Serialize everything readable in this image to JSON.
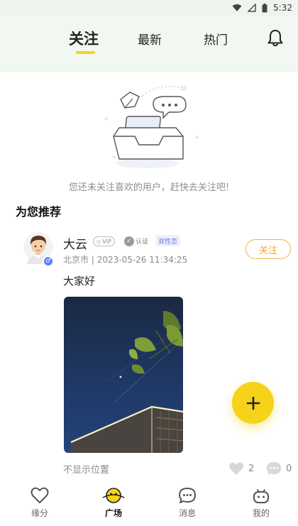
{
  "status_bar": {
    "time": "5:32"
  },
  "header": {
    "tabs": [
      {
        "label": "关注",
        "active": true
      },
      {
        "label": "最新",
        "active": false
      },
      {
        "label": "热门",
        "active": false
      }
    ],
    "accent_color": "#f6d21e"
  },
  "empty_state": {
    "message": "您还未关注喜欢的用户，赶快去关注吧!"
  },
  "recommend": {
    "title": "为您推荐",
    "post": {
      "username": "大云",
      "vip_label": "VIP",
      "verify_label": "认证",
      "attribute_label": "双性恋",
      "location": "北京市",
      "timestamp": "2023-05-26 11:34:25",
      "follow_label": "关注",
      "text": "大家好",
      "location_footer": "不显示位置",
      "likes": "2",
      "comments": "0"
    }
  },
  "fab": {
    "icon": "plus-icon"
  },
  "bottom_nav": {
    "items": [
      {
        "label": "缘分",
        "icon": "heart-icon",
        "active": false
      },
      {
        "label": "广场",
        "icon": "planet-icon",
        "active": true
      },
      {
        "label": "消息",
        "icon": "chat-icon",
        "active": false
      },
      {
        "label": "我的",
        "icon": "robot-icon",
        "active": false
      }
    ]
  }
}
